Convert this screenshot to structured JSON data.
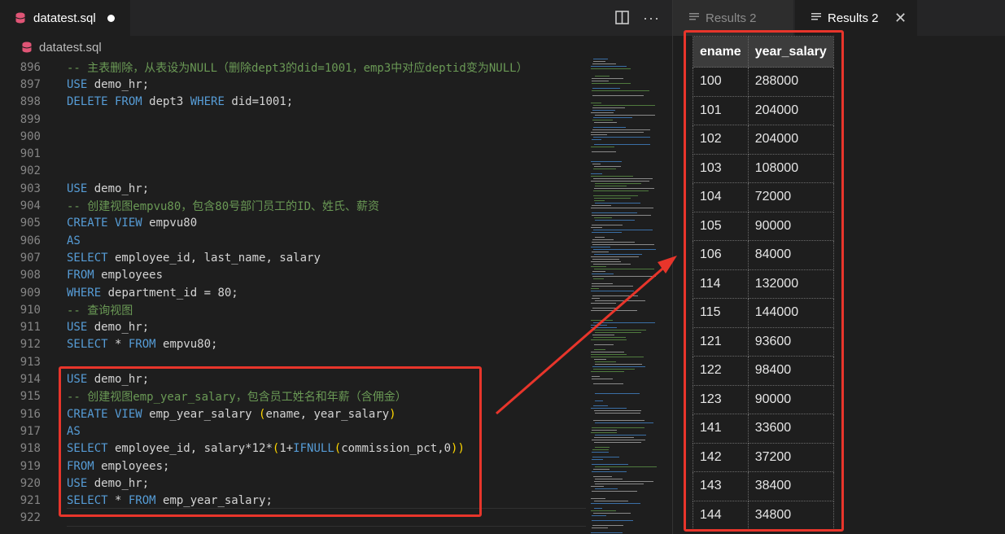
{
  "editor": {
    "tab_label": "datatest.sql",
    "breadcrumb": "datatest.sql",
    "lines": [
      {
        "n": "896",
        "segs": [
          [
            "cm",
            "-- 主表删除，从表设为NULL（删除dept3的did=1001，emp3中对应deptid变为NULL）"
          ]
        ]
      },
      {
        "n": "897",
        "segs": [
          [
            "kw",
            "USE"
          ],
          [
            "txt",
            " demo_hr;"
          ]
        ]
      },
      {
        "n": "898",
        "segs": [
          [
            "kw",
            "DELETE FROM"
          ],
          [
            "txt",
            " dept3 "
          ],
          [
            "kw",
            "WHERE"
          ],
          [
            "txt",
            " did=1001;"
          ]
        ]
      },
      {
        "n": "899",
        "segs": []
      },
      {
        "n": "900",
        "segs": []
      },
      {
        "n": "901",
        "segs": []
      },
      {
        "n": "902",
        "segs": []
      },
      {
        "n": "903",
        "segs": [
          [
            "kw",
            "USE"
          ],
          [
            "txt",
            " demo_hr;"
          ]
        ]
      },
      {
        "n": "904",
        "segs": [
          [
            "cm",
            "-- 创建视图empvu80，包含80号部门员工的ID、姓氏、薪资"
          ]
        ]
      },
      {
        "n": "905",
        "segs": [
          [
            "kw",
            "CREATE VIEW"
          ],
          [
            "txt",
            " empvu80"
          ]
        ]
      },
      {
        "n": "906",
        "segs": [
          [
            "kw",
            "AS"
          ]
        ]
      },
      {
        "n": "907",
        "segs": [
          [
            "kw",
            "SELECT"
          ],
          [
            "txt",
            " employee_id, last_name, salary"
          ]
        ]
      },
      {
        "n": "908",
        "segs": [
          [
            "kw",
            "FROM"
          ],
          [
            "txt",
            " employees"
          ]
        ]
      },
      {
        "n": "909",
        "segs": [
          [
            "kw",
            "WHERE"
          ],
          [
            "txt",
            " department_id = 80;"
          ]
        ]
      },
      {
        "n": "910",
        "segs": [
          [
            "cm",
            "-- 查询视图"
          ]
        ]
      },
      {
        "n": "911",
        "segs": [
          [
            "kw",
            "USE"
          ],
          [
            "txt",
            " demo_hr;"
          ]
        ]
      },
      {
        "n": "912",
        "segs": [
          [
            "kw",
            "SELECT"
          ],
          [
            "txt",
            " * "
          ],
          [
            "kw",
            "FROM"
          ],
          [
            "txt",
            " empvu80;"
          ]
        ]
      },
      {
        "n": "913",
        "segs": []
      },
      {
        "n": "914",
        "segs": [
          [
            "kw",
            "USE"
          ],
          [
            "txt",
            " demo_hr;"
          ]
        ]
      },
      {
        "n": "915",
        "segs": [
          [
            "cm",
            "-- 创建视图emp_year_salary，包含员工姓名和年薪（含佣金）"
          ]
        ]
      },
      {
        "n": "916",
        "segs": [
          [
            "kw",
            "CREATE VIEW"
          ],
          [
            "txt",
            " emp_year_salary "
          ],
          [
            "pa",
            "("
          ],
          [
            "txt",
            "ename, year_salary"
          ],
          [
            "pa",
            ")"
          ]
        ]
      },
      {
        "n": "917",
        "segs": [
          [
            "kw",
            "AS"
          ]
        ]
      },
      {
        "n": "918",
        "segs": [
          [
            "kw",
            "SELECT"
          ],
          [
            "txt",
            " employee_id, salary*12*"
          ],
          [
            "pa",
            "("
          ],
          [
            "txt",
            "1+"
          ],
          [
            "fn",
            "IFNULL"
          ],
          [
            "pa",
            "("
          ],
          [
            "txt",
            "commission_pct,0"
          ],
          [
            "pa",
            "))"
          ]
        ]
      },
      {
        "n": "919",
        "segs": [
          [
            "kw",
            "FROM"
          ],
          [
            "txt",
            " employees;"
          ]
        ]
      },
      {
        "n": "920",
        "segs": [
          [
            "kw",
            "USE"
          ],
          [
            "txt",
            " demo_hr;"
          ]
        ]
      },
      {
        "n": "921",
        "segs": [
          [
            "kw",
            "SELECT"
          ],
          [
            "txt",
            " * "
          ],
          [
            "kw",
            "FROM"
          ],
          [
            "txt",
            " emp_year_salary;"
          ]
        ]
      },
      {
        "n": "922",
        "segs": []
      }
    ]
  },
  "results": {
    "tab1_label": "Results 2",
    "tab2_label": "Results 2",
    "columns": [
      "ename",
      "year_salary"
    ],
    "rows": [
      [
        "100",
        "288000"
      ],
      [
        "101",
        "204000"
      ],
      [
        "102",
        "204000"
      ],
      [
        "103",
        "108000"
      ],
      [
        "104",
        "72000"
      ],
      [
        "105",
        "90000"
      ],
      [
        "106",
        "84000"
      ],
      [
        "114",
        "132000"
      ],
      [
        "115",
        "144000"
      ],
      [
        "121",
        "93600"
      ],
      [
        "122",
        "98400"
      ],
      [
        "123",
        "90000"
      ],
      [
        "141",
        "33600"
      ],
      [
        "142",
        "37200"
      ],
      [
        "143",
        "38400"
      ],
      [
        "144",
        "34800"
      ]
    ]
  },
  "colors": {
    "accent_red": "#e8352b",
    "keyword": "#569cd6",
    "comment": "#6a9955",
    "db_icon": "#e05576"
  },
  "icons": [
    "database-icon",
    "split-editor-icon",
    "more-actions-icon",
    "list-icon",
    "close-icon"
  ]
}
